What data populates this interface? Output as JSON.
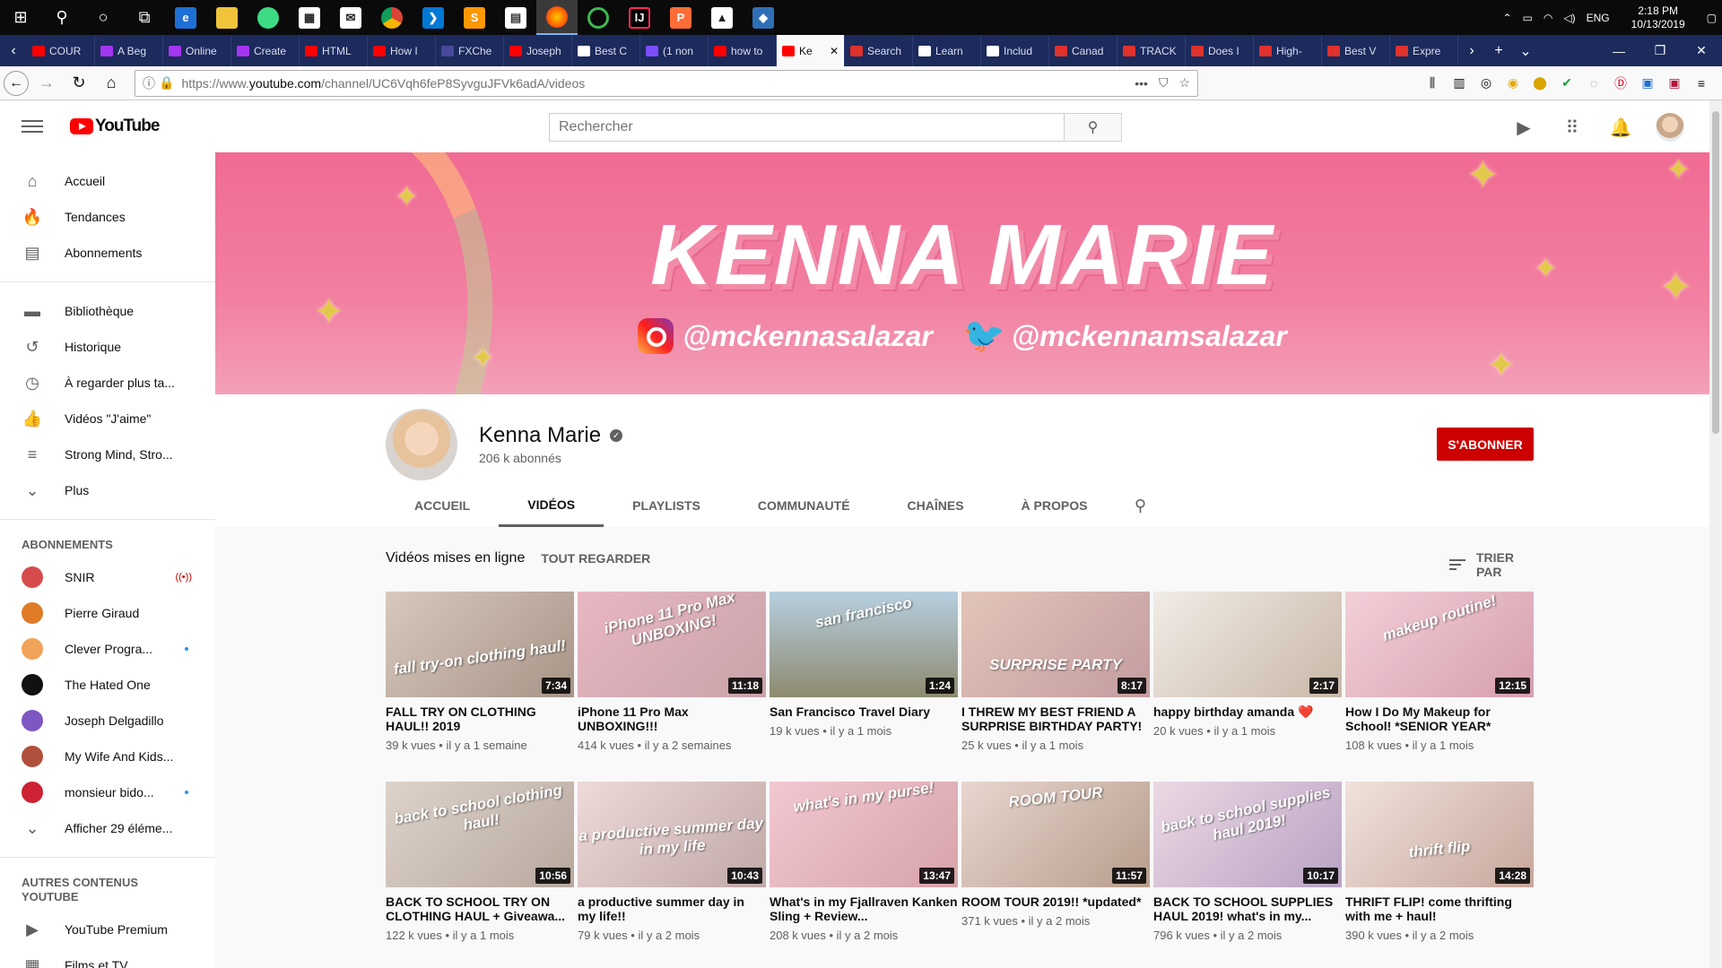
{
  "taskbar": {
    "time": "2:18 PM",
    "date": "10/13/2019",
    "lang": "ENG"
  },
  "browser_tabs": [
    {
      "label": "COUR",
      "color": "#ff0000"
    },
    {
      "label": "A Beg",
      "color": "#a435f0"
    },
    {
      "label": "Online",
      "color": "#a435f0"
    },
    {
      "label": "Create",
      "color": "#a435f0"
    },
    {
      "label": "HTML",
      "color": "#ff0000"
    },
    {
      "label": "How I",
      "color": "#ff0000"
    },
    {
      "label": "FXChe",
      "color": "#4a4a9a"
    },
    {
      "label": "Joseph",
      "color": "#ff0000"
    },
    {
      "label": "Best C",
      "color": "#ffffff"
    },
    {
      "label": "(1 non",
      "color": "#7c4dff"
    },
    {
      "label": "how to",
      "color": "#ff0000"
    },
    {
      "label": "Ke",
      "color": "#ff0000",
      "active": true
    },
    {
      "label": "Search",
      "color": "#e0312c"
    },
    {
      "label": "Learn",
      "color": "#ffffff"
    },
    {
      "label": "Includ",
      "color": "#ffffff"
    },
    {
      "label": "Canad",
      "color": "#e0312c"
    },
    {
      "label": "TRACK",
      "color": "#e0312c"
    },
    {
      "label": "Does I",
      "color": "#e0312c"
    },
    {
      "label": "High-",
      "color": "#e0312c"
    },
    {
      "label": "Best V",
      "color": "#e0312c"
    },
    {
      "label": "Expre",
      "color": "#e0312c"
    }
  ],
  "url": {
    "prefix": "https://www.",
    "domain": "youtube.com",
    "path": "/channel/UC6Vqh6feP8SyvguJFVk6adA/videos"
  },
  "masthead": {
    "logo_text": "YouTube",
    "search_placeholder": "Rechercher"
  },
  "sidebar": {
    "main": [
      {
        "label": "Accueil",
        "icon": "home-icon",
        "glyph": "⌂"
      },
      {
        "label": "Tendances",
        "icon": "fire-icon",
        "glyph": "🔥"
      },
      {
        "label": "Abonnements",
        "icon": "subscriptions-icon",
        "glyph": "▤"
      }
    ],
    "library": [
      {
        "label": "Bibliothèque",
        "icon": "folder-icon",
        "glyph": "▬"
      },
      {
        "label": "Historique",
        "icon": "history-icon",
        "glyph": "↺"
      },
      {
        "label": "À regarder plus ta...",
        "icon": "clock-icon",
        "glyph": "◷"
      },
      {
        "label": "Vidéos \"J'aime\"",
        "icon": "thumbs-up-icon",
        "glyph": "👍"
      },
      {
        "label": "Strong Mind, Stro...",
        "icon": "playlist-icon",
        "glyph": "≡"
      },
      {
        "label": "Plus",
        "icon": "chevron-down-icon",
        "glyph": "⌄"
      }
    ],
    "subs_heading": "ABONNEMENTS",
    "subs": [
      {
        "label": "SNIR",
        "color": "#d64c4c",
        "badge": "live"
      },
      {
        "label": "Pierre Giraud",
        "color": "#e07b28",
        "badge": ""
      },
      {
        "label": "Clever Progra...",
        "color": "#f2a35a",
        "badge": "dot"
      },
      {
        "label": "The Hated One",
        "color": "#111111",
        "badge": ""
      },
      {
        "label": "Joseph Delgadillo",
        "color": "#7e57c2",
        "badge": ""
      },
      {
        "label": "My Wife And Kids...",
        "color": "#b0503c",
        "badge": ""
      },
      {
        "label": "monsieur bido...",
        "color": "#cc2233",
        "badge": "dot"
      }
    ],
    "show_more": "Afficher 29 éléme...",
    "other_heading": "AUTRES CONTENUS YOUTUBE",
    "other": [
      {
        "label": "YouTube Premium",
        "icon": "youtube-premium-icon",
        "glyph": "▶"
      },
      {
        "label": "Films et TV",
        "icon": "film-icon",
        "glyph": "▦"
      }
    ]
  },
  "banner": {
    "title": "KENNA MARIE",
    "instagram": "@mckennasalazar",
    "twitter": "@mckennamsalazar"
  },
  "channel": {
    "name": "Kenna Marie",
    "subscribers": "206 k abonnés",
    "subscribe_label": "S'ABONNER",
    "tabs": [
      "ACCUEIL",
      "VIDÉOS",
      "PLAYLISTS",
      "COMMUNAUTÉ",
      "CHAÎNES",
      "À PROPOS"
    ],
    "active_tab": "VIDÉOS"
  },
  "section": {
    "title": "Vidéos mises en ligne",
    "see_all": "TOUT REGARDER",
    "sort": "TRIER PAR"
  },
  "videos": [
    {
      "title": "FALL TRY ON CLOTHING HAUL!! 2019",
      "views": "39 k vues",
      "age": "il y a 1 semaine",
      "duration": "7:34",
      "overlay": "fall try-on clothing haul!",
      "bg": "linear-gradient(135deg,#d8c9bd,#a79487)"
    },
    {
      "title": "iPhone 11 Pro Max UNBOXING!!!",
      "views": "414 k vues",
      "age": "il y a 2 semaines",
      "duration": "11:18",
      "overlay": "iPhone 11 Pro Max UNBOXING!",
      "bg": "linear-gradient(135deg,#e9b7c3,#c8a3a8)"
    },
    {
      "title": "San Francisco Travel Diary",
      "views": "19 k vues",
      "age": "il y a 1 mois",
      "duration": "1:24",
      "overlay": "san francisco",
      "bg": "linear-gradient(180deg,#b7cfe0,#8d8a6f)"
    },
    {
      "title": "I THREW MY BEST FRIEND A SURPRISE BIRTHDAY PARTY!",
      "views": "25 k vues",
      "age": "il y a 1 mois",
      "duration": "8:17",
      "overlay": "SURPRISE PARTY",
      "bg": "linear-gradient(135deg,#e2c5b9,#c39ca0)"
    },
    {
      "title": "happy birthday amanda ❤️",
      "views": "20 k vues",
      "age": "il y a 1 mois",
      "duration": "2:17",
      "overlay": "",
      "bg": "linear-gradient(135deg,#f1ece6,#c9b8a8)"
    },
    {
      "title": "How I Do My Makeup for School! *SENIOR YEAR*",
      "views": "108 k vues",
      "age": "il y a 1 mois",
      "duration": "12:15",
      "overlay": "makeup routine!",
      "bg": "linear-gradient(135deg,#f3cfd8,#d69fae)"
    },
    {
      "title": "BACK TO SCHOOL TRY ON CLOTHING HAUL + Giveawa...",
      "views": "122 k vues",
      "age": "il y a 1 mois",
      "duration": "10:56",
      "overlay": "back to school clothing haul!",
      "bg": "linear-gradient(135deg,#ddd3cb,#b8a89e)"
    },
    {
      "title": "a productive summer day in my life!!",
      "views": "79 k vues",
      "age": "il y a 2 mois",
      "duration": "10:43",
      "overlay": "a productive summer day in my life",
      "bg": "linear-gradient(135deg,#efd9d9,#bfa8a6)"
    },
    {
      "title": "What's in my Fjallraven Kanken Sling + Review...",
      "views": "208 k vues",
      "age": "il y a 2 mois",
      "duration": "13:47",
      "overlay": "what's in my purse!",
      "bg": "linear-gradient(135deg,#f2c8d1,#d7a3a9)"
    },
    {
      "title": "ROOM TOUR 2019!! *updated*",
      "views": "371 k vues",
      "age": "il y a 2 mois",
      "duration": "11:57",
      "overlay": "ROOM TOUR",
      "bg": "linear-gradient(135deg,#e8d6cf,#b79d8c)"
    },
    {
      "title": "BACK TO SCHOOL SUPPLIES HAUL 2019! what's in my...",
      "views": "796 k vues",
      "age": "il y a 2 mois",
      "duration": "10:17",
      "overlay": "back to school supplies haul 2019!",
      "bg": "linear-gradient(135deg,#ecd9e4,#b8a2c3)"
    },
    {
      "title": "THRIFT FLIP! come thrifting with me + haul!",
      "views": "390 k vues",
      "age": "il y a 2 mois",
      "duration": "14:28",
      "overlay": "thrift flip",
      "bg": "linear-gradient(135deg,#f0e2dc,#c7a79c)"
    }
  ]
}
